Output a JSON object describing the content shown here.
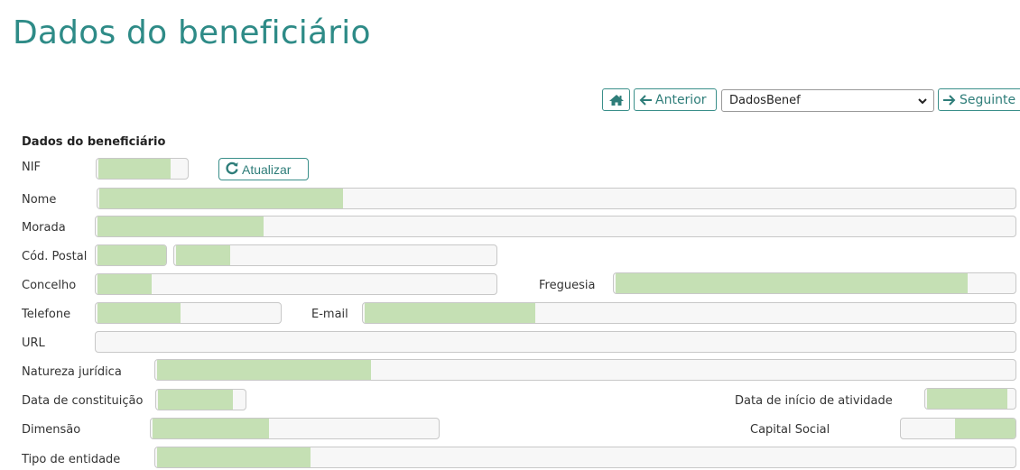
{
  "page": {
    "title": "Dados do beneficiário"
  },
  "nav": {
    "anterior_label": "Anterior",
    "seguinte_label": "Seguinte",
    "select_value": "DadosBenef"
  },
  "section": {
    "title": "Dados do beneficiário"
  },
  "labels": {
    "nif": "NIF",
    "nome": "Nome",
    "morada": "Morada",
    "cod_postal": "Cód. Postal",
    "concelho": "Concelho",
    "freguesia": "Freguesia",
    "telefone": "Telefone",
    "email": "E-mail",
    "url": "URL",
    "natureza": "Natureza jurídica",
    "data_const": "Data de constituição",
    "data_inicio": "Data de início de atividade",
    "dimensao": "Dimensão",
    "capital": "Capital Social",
    "tipo": "Tipo de entidade"
  },
  "buttons": {
    "atualizar": "Atualizar"
  },
  "colors": {
    "accent": "#2e8b87",
    "redaction": "#c5e0b4"
  }
}
